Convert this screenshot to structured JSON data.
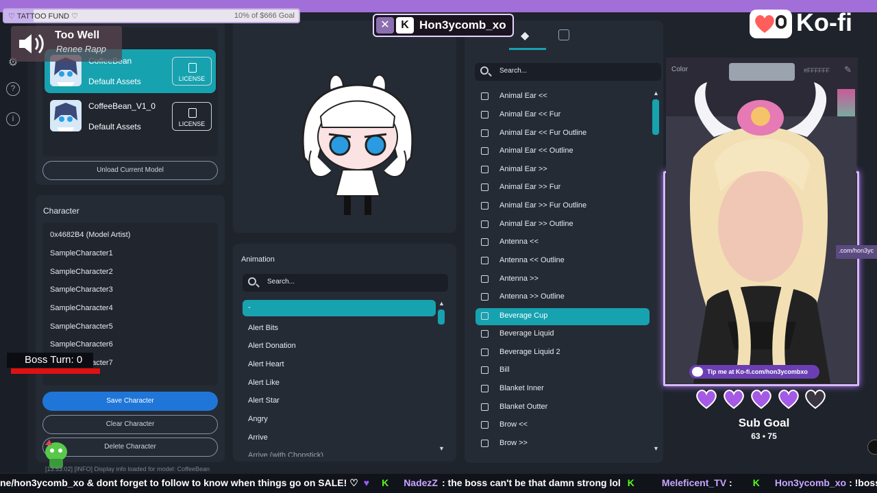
{
  "goal_overlay": {
    "title": "♡ TATTOO FUND ♡",
    "progress_text": "10% of $666 Goal",
    "progress": 0.1
  },
  "now_playing": {
    "song": "Too Well",
    "artist": "Renee Rapp"
  },
  "streamer_tag": {
    "handle": "Hon3ycomb_xo"
  },
  "kofi_logo": {
    "text": "Ko-fi"
  },
  "models": [
    {
      "name": "CoffeeBean",
      "sub": "Default Assets",
      "license": "LICENSE",
      "active": true
    },
    {
      "name": "CoffeeBean_V1_0",
      "sub": "Default Assets",
      "license": "LICENSE",
      "active": false
    }
  ],
  "unload_button": "Unload Current Model",
  "character": {
    "title": "Character",
    "items": [
      "0x4682B4 (Model Artist)",
      "SampleCharacter1",
      "SampleCharacter2",
      "SampleCharacter3",
      "SampleCharacter4",
      "SampleCharacter5",
      "SampleCharacter6",
      "SampleCharacter7"
    ],
    "save": "Save Character",
    "clear": "Clear Character",
    "delete": "Delete Character"
  },
  "boss": {
    "label": "Boss Turn: 0"
  },
  "animation": {
    "title": "Animation",
    "search_placeholder": "Search...",
    "selected": "-",
    "items": [
      "Alert Bits",
      "Alert Donation",
      "Alert Heart",
      "Alert Like",
      "Alert Star",
      "Angry",
      "Arrive",
      "Arrive (with Chopstick)"
    ]
  },
  "parts": {
    "search_placeholder": "Search...",
    "items": [
      "Animal Ear <<",
      "Animal Ear << Fur",
      "Animal Ear << Fur Outline",
      "Animal Ear << Outline",
      "Animal Ear >>",
      "Animal Ear >> Fur",
      "Animal Ear >> Fur Outline",
      "Animal Ear >> Outline",
      "Antenna <<",
      "Antenna << Outline",
      "Antenna >>",
      "Antenna >> Outline",
      "Beverage Cup",
      "Beverage Liquid",
      "Beverage Liquid 2",
      "Bill",
      "Blanket Inner",
      "Blanket Outter",
      "Brow <<",
      "Brow >>"
    ],
    "selected_index": 12
  },
  "color_panel": {
    "label": "Color",
    "hex": "#FFFFFF"
  },
  "webcam": {
    "kofi_tip": "Tip me at Ko-fi.com/hon3ycombxo",
    "side_text": ".com/hon3yc"
  },
  "sub_goal": {
    "title": "Sub Goal",
    "count": "63 • 75",
    "hearts_filled": 4,
    "hearts_total": 5
  },
  "log_line": "[13:53:02] [INFO] Display info loaded for model: CoffeeBean",
  "ticker": {
    "text1": "ne/hon3ycomb_xo & dont forget to follow to know when things go on SALE! ♡",
    "user1": "NadezZ",
    "msg1": ": the boss can't be that damn strong lol",
    "user2": "Meleficent_TV",
    "msg2": ":",
    "user3": "Hon3ycomb_xo",
    "msg3": ": !boss"
  }
}
